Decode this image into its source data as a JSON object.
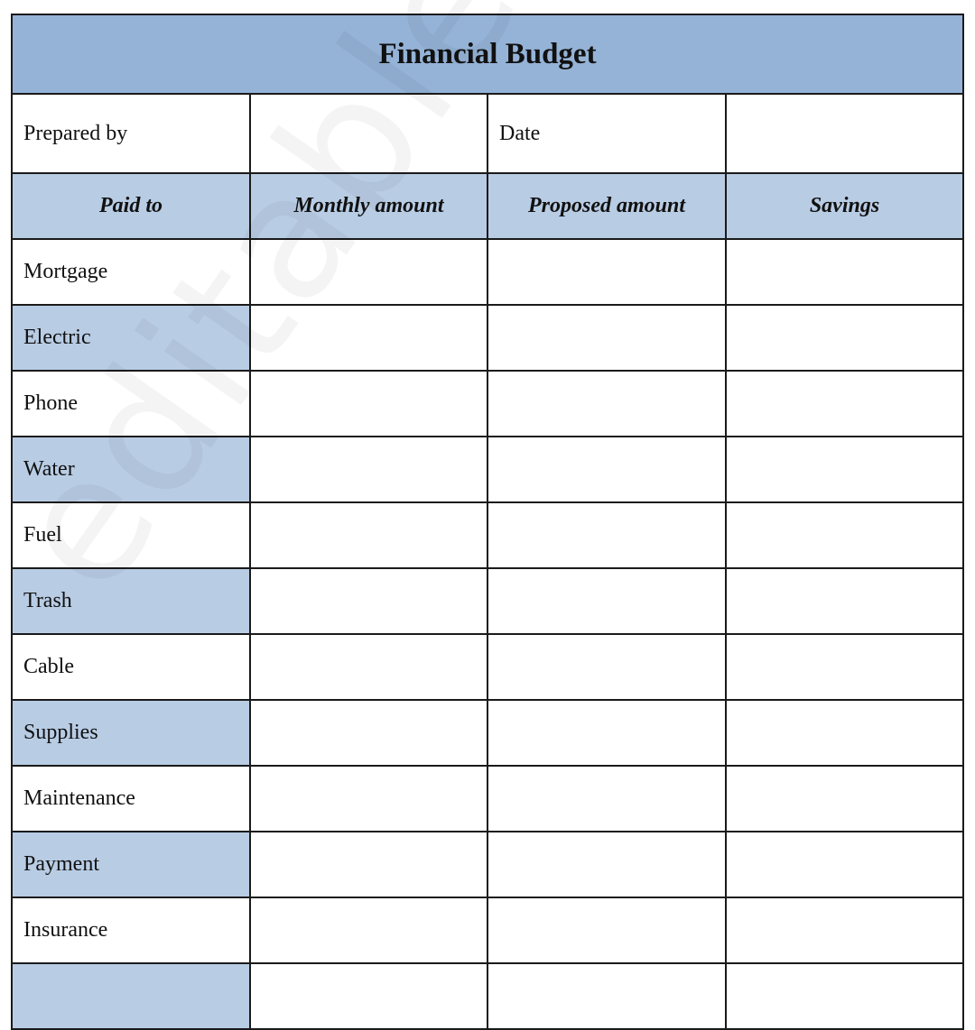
{
  "form": {
    "title": "Financial Budget",
    "meta": {
      "prepared_by_label": "Prepared by",
      "prepared_by_value": "",
      "date_label": "Date",
      "date_value": ""
    },
    "columns": [
      "Paid to",
      "Monthly amount",
      "Proposed amount",
      "Savings"
    ],
    "rows": [
      {
        "paid_to": "Mortgage",
        "monthly": "",
        "proposed": "",
        "savings": ""
      },
      {
        "paid_to": "Electric",
        "monthly": "",
        "proposed": "",
        "savings": ""
      },
      {
        "paid_to": "Phone",
        "monthly": "",
        "proposed": "",
        "savings": ""
      },
      {
        "paid_to": "Water",
        "monthly": "",
        "proposed": "",
        "savings": ""
      },
      {
        "paid_to": "Fuel",
        "monthly": "",
        "proposed": "",
        "savings": ""
      },
      {
        "paid_to": "Trash",
        "monthly": "",
        "proposed": "",
        "savings": ""
      },
      {
        "paid_to": "Cable",
        "monthly": "",
        "proposed": "",
        "savings": ""
      },
      {
        "paid_to": "Supplies",
        "monthly": "",
        "proposed": "",
        "savings": ""
      },
      {
        "paid_to": "Maintenance",
        "monthly": "",
        "proposed": "",
        "savings": ""
      },
      {
        "paid_to": "Payment",
        "monthly": "",
        "proposed": "",
        "savings": ""
      },
      {
        "paid_to": "Insurance",
        "monthly": "",
        "proposed": "",
        "savings": ""
      },
      {
        "paid_to": "",
        "monthly": "",
        "proposed": "",
        "savings": ""
      }
    ]
  },
  "colors": {
    "title_bg": "#95b3d7",
    "header_bg": "#b8cce4",
    "shaded_row_bg": "#b8cce4",
    "border": "#1a1a1a"
  },
  "watermark": "editableforms.com"
}
